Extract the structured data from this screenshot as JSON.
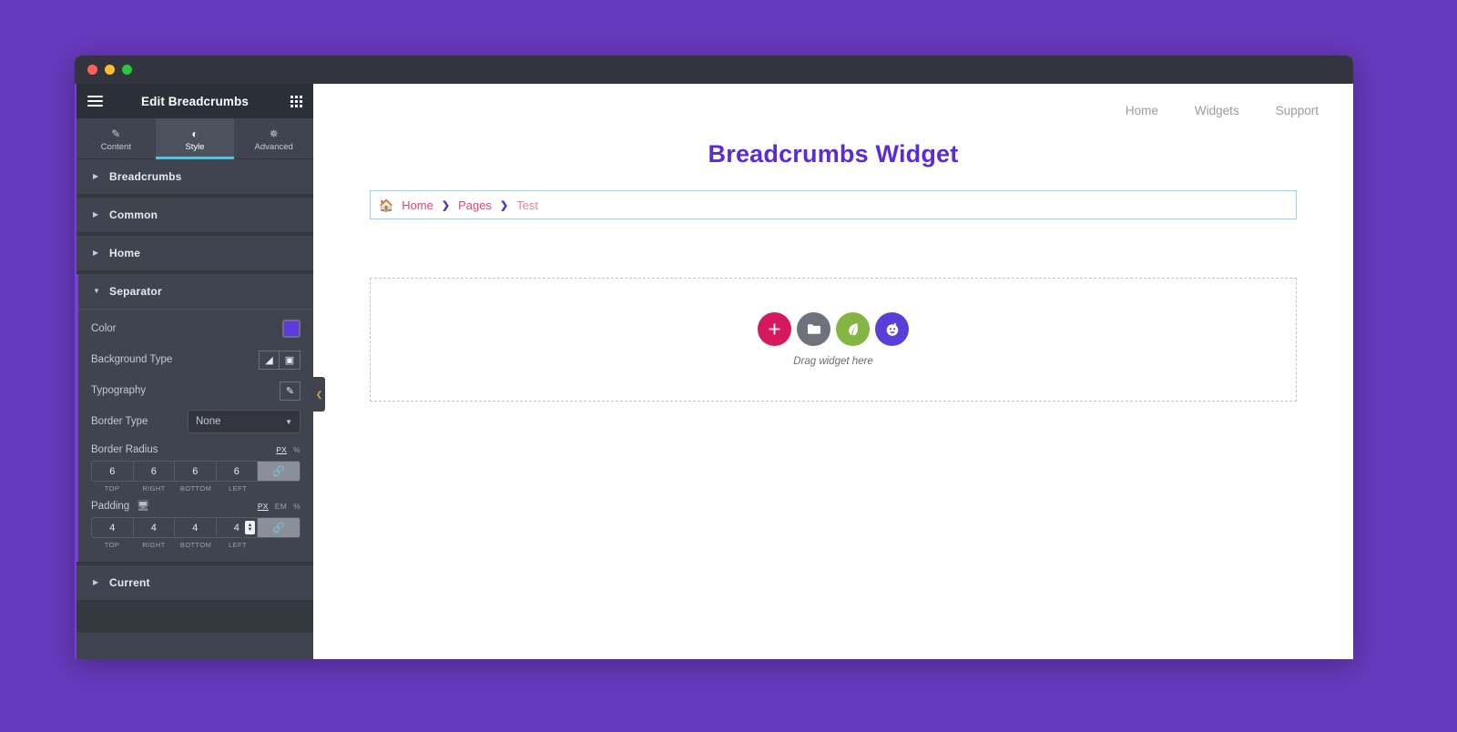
{
  "window": {
    "traffic_lights": [
      "close",
      "minimize",
      "maximize"
    ]
  },
  "panel": {
    "header": {
      "menu_icon": "hamburger-icon",
      "title": "Edit Breadcrumbs",
      "grid_icon": "widgets-grid-icon"
    },
    "tabs": [
      {
        "label": "Content",
        "icon": "pencil-icon",
        "active": false
      },
      {
        "label": "Style",
        "icon": "contrast-icon",
        "active": true
      },
      {
        "label": "Advanced",
        "icon": "gear-icon",
        "active": false
      }
    ],
    "sections": [
      {
        "title": "Breadcrumbs",
        "open": false
      },
      {
        "title": "Common",
        "open": false
      },
      {
        "title": "Home",
        "open": false
      },
      {
        "title": "Separator",
        "open": true
      },
      {
        "title": "Current",
        "open": false
      }
    ],
    "separator_controls": {
      "color": {
        "label": "Color",
        "value": "#6038e0"
      },
      "background_type": {
        "label": "Background Type",
        "options": [
          "classic",
          "gradient"
        ],
        "icons": [
          "brush-icon",
          "gradient-icon"
        ]
      },
      "typography": {
        "label": "Typography",
        "icon": "pencil-edit-icon"
      },
      "border_type": {
        "label": "Border Type",
        "value": "None"
      },
      "border_radius": {
        "label": "Border Radius",
        "units": [
          "PX",
          "%"
        ],
        "active_unit": "PX",
        "values": [
          "6",
          "6",
          "6",
          "6"
        ],
        "legend": [
          "TOP",
          "RIGHT",
          "BOTTOM",
          "LEFT"
        ],
        "link_icon": "link-icon",
        "linked": true
      },
      "padding": {
        "label": "Padding",
        "device_icon": "desktop-icon",
        "units": [
          "PX",
          "EM",
          "%"
        ],
        "active_unit": "PX",
        "values": [
          "4",
          "4",
          "4",
          "4"
        ],
        "legend": [
          "TOP",
          "RIGHT",
          "BOTTOM",
          "LEFT"
        ],
        "link_icon": "link-icon",
        "linked": true
      }
    },
    "collapse_handle": {
      "icon": "chevron-left-icon"
    }
  },
  "canvas": {
    "site_nav": [
      {
        "label": "Home"
      },
      {
        "label": "Widgets"
      },
      {
        "label": "Support"
      }
    ],
    "page_title": "Breadcrumbs Widget",
    "breadcrumb": {
      "home_icon": "house-icon",
      "items": [
        {
          "label": "Home",
          "type": "link"
        },
        {
          "label": "Pages",
          "type": "link"
        },
        {
          "label": "Test",
          "type": "current"
        }
      ],
      "separator": "❯",
      "link_color": "#e3446f",
      "separator_color": "#5a2fd0",
      "current_color": "#ef8296",
      "outline_color": "#8ed8f2"
    },
    "dropzone": {
      "buttons": [
        {
          "name": "add-widget-button",
          "icon": "plus-icon",
          "color": "#d6185f"
        },
        {
          "name": "folder-templates-button",
          "icon": "folder-icon",
          "color": "#6d727c"
        },
        {
          "name": "envato-kit-button",
          "icon": "leaf-icon",
          "color": "#82b541"
        },
        {
          "name": "ai-button",
          "icon": "ai-face-icon",
          "color": "#5a3fd6"
        }
      ],
      "text": "Drag widget here"
    }
  },
  "theme": {
    "page_background": "#6739bc",
    "panel_background": "#3f444e",
    "panel_header_background": "#2b2f38",
    "accent": "#52c2e6"
  }
}
